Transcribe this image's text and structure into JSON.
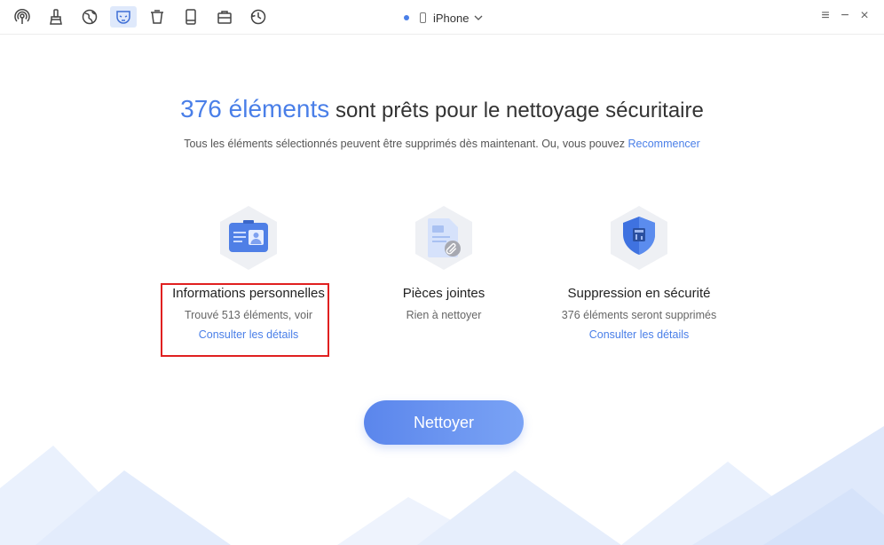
{
  "toolbar": {
    "tools": [
      {
        "icon": "airdrop-icon"
      },
      {
        "icon": "brush-icon"
      },
      {
        "icon": "globe-icon"
      },
      {
        "icon": "mask-icon",
        "active": true
      },
      {
        "icon": "trash-bin-icon"
      },
      {
        "icon": "tablet-icon"
      },
      {
        "icon": "toolbox-icon"
      },
      {
        "icon": "history-icon"
      }
    ],
    "device_name": "iPhone",
    "window_controls": {
      "menu": "≡",
      "minimize": "−",
      "close": "×"
    }
  },
  "header": {
    "count": "376 éléments",
    "title_rest": "sont prêts pour le nettoyage sécuritaire",
    "subtitle": "Tous les éléments sélectionnés peuvent être supprimés dès maintenant. Ou, vous pouvez",
    "restart_link": "Recommencer"
  },
  "cards": [
    {
      "title": "Informations personnelles",
      "subtitle": "Trouvé 513 éléments, voir",
      "link": "Consulter les détails"
    },
    {
      "title": "Pièces jointes",
      "subtitle": "Rien à nettoyer"
    },
    {
      "title": "Suppression en sécurité",
      "subtitle": "376 éléments seront supprimés",
      "link": "Consulter les détails"
    }
  ],
  "action": {
    "clean_label": "Nettoyer"
  },
  "colors": {
    "accent": "#4a7fe8",
    "highlight": "#e02020"
  }
}
